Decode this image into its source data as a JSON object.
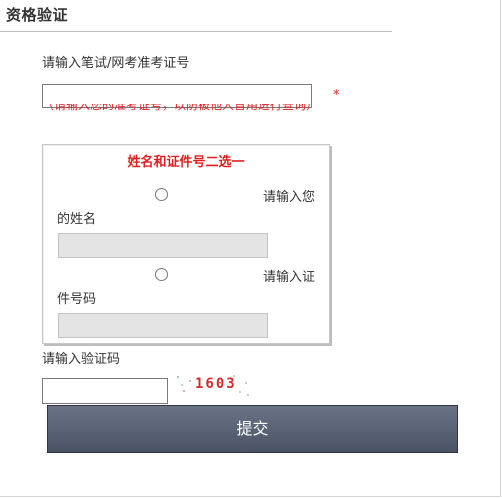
{
  "page": {
    "title": "资格验证"
  },
  "form": {
    "exam_id_label": "请输入笔试/网考准考证号",
    "exam_id_value": "",
    "required_mark": "*",
    "error_text": "（请输入您的准考证号，以防被他人冒用进行查询）",
    "choose": {
      "title": "姓名和证件号二选一",
      "name_option_label_a": "请输入您",
      "name_option_label_b": "的姓名",
      "name_value": "",
      "id_option_label_a": "请输入证",
      "id_option_label_b": "件号码",
      "id_value": ""
    },
    "captcha_label": "请输入验证码",
    "captcha_value": "",
    "captcha_text": "1603",
    "submit_label": "提交"
  },
  "colors": {
    "accent_red": "#e02020",
    "button_top": "#6b7487",
    "button_bottom": "#4a5264"
  }
}
